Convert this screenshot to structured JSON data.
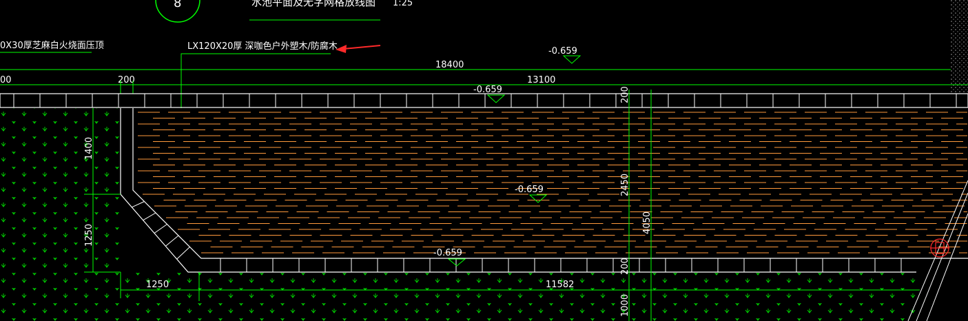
{
  "drawing": {
    "title_text": "水池平面及无字网格放线图",
    "scale_text": "1:25",
    "section_marker": "8",
    "coping_note": "0X30厚芝麻白火烧面压顶",
    "deck_note": "LX120X20厚 深咖色户外塑木/防腐木"
  },
  "elevations": [
    "-0.659",
    "-0.659",
    "-0.659",
    "-0.659"
  ],
  "dimensions": {
    "overall_width": "18400",
    "left_edge_stub": "00",
    "coping_width_top": "200",
    "deck_width": "13100",
    "vertical_top_coping": "200",
    "vertical_deck_depth": "2450",
    "vertical_total": "4050",
    "vertical_bottom_coping": "200",
    "vertical_below": "1000",
    "left_upper": "1400",
    "left_lower": "1250",
    "bottom_left": "1250",
    "bottom_run": "11582"
  },
  "colors": {
    "background": "#000000",
    "line_white": "#ffffff",
    "dim_green": "#00ff00",
    "plank_orange": "#ff9a3c",
    "arrow_red": "#ff2a2a",
    "hatch_green": "#00e000"
  }
}
